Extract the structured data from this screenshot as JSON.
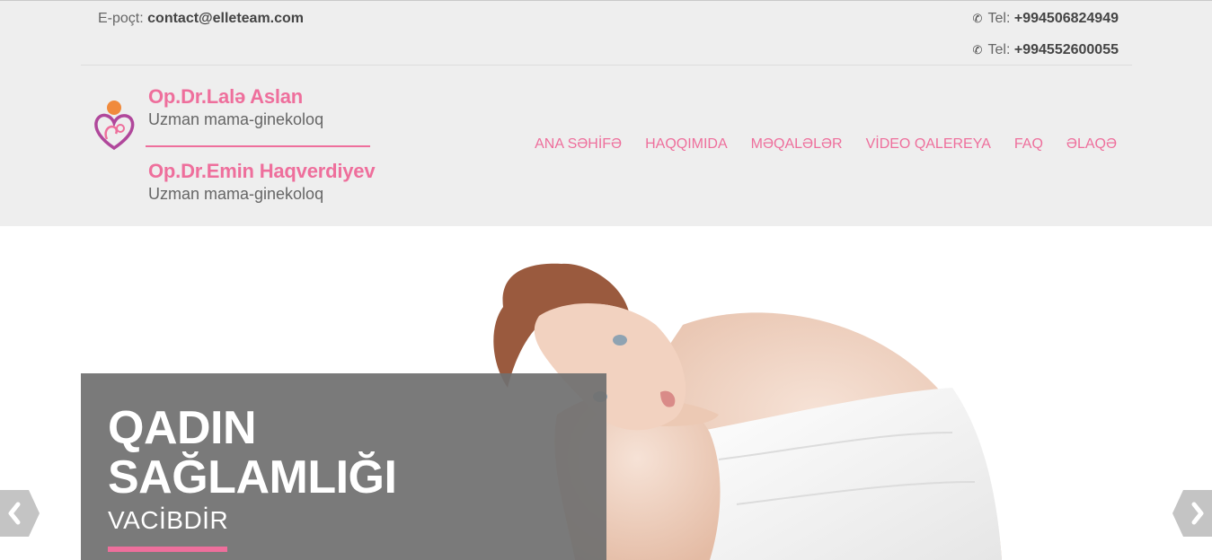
{
  "topbar": {
    "email_label": "E-poçt: ",
    "email_value": "contact@elleteam.com",
    "phone_label": "Tel: ",
    "phones": [
      "+994506824949",
      "+994552600055"
    ]
  },
  "doctors": [
    {
      "name": "Op.Dr.Lalə Aslan",
      "title": "Uzman mama-ginekoloq"
    },
    {
      "name": "Op.Dr.Emin Haqverdiyev",
      "title": "Uzman mama-ginekoloq"
    }
  ],
  "nav": {
    "items": [
      {
        "label": "ANA SƏHİFƏ"
      },
      {
        "label": "HAQQIMIDA"
      },
      {
        "label": "MƏQALƏLƏR"
      },
      {
        "label": "VİDEO QALEREYA"
      },
      {
        "label": "FAQ"
      },
      {
        "label": "ƏLAQƏ"
      }
    ]
  },
  "slider": {
    "title_line1": "QADIN",
    "title_line2": "SAĞLAMLIĞI",
    "subtitle": "VACİBDİR"
  },
  "colors": {
    "accent": "#ee6f9c",
    "header_bg": "#eeeeee",
    "caption_bg": "#707070"
  },
  "icons": {
    "phone": "phone-icon",
    "logo": "heart-mother-baby-logo",
    "prev": "chevron-left-icon",
    "next": "chevron-right-icon"
  }
}
